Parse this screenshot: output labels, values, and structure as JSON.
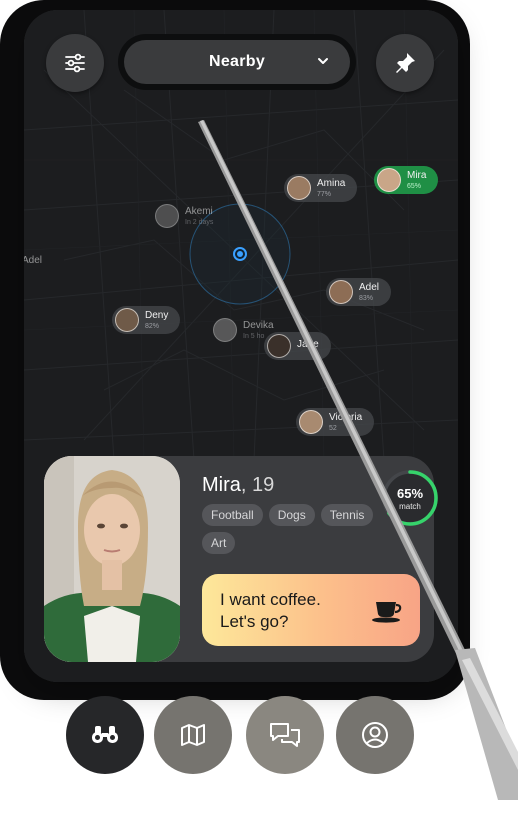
{
  "header": {
    "location_filter": "Nearby"
  },
  "icons": {
    "filter": "sliders-icon",
    "pin": "pushpin-icon",
    "dropdown": "chevron-down-icon",
    "coffee": "coffee-cup-icon",
    "nav": [
      "binoculars-icon",
      "map-icon",
      "chat-bubbles-icon",
      "user-circle-icon"
    ]
  },
  "map": {
    "edge_label": "Adel",
    "people": [
      {
        "name": "Amina",
        "info": "77%"
      },
      {
        "name": "Mira",
        "info": "65%"
      },
      {
        "name": "Akemi",
        "info": "In 2 days"
      },
      {
        "name": "Adel",
        "info": "83%"
      },
      {
        "name": "Deny",
        "info": "82%"
      },
      {
        "name": "Devika",
        "info": "In 5 ho"
      },
      {
        "name": "Jane",
        "info": ""
      },
      {
        "name": "Victoria",
        "info": "52"
      }
    ]
  },
  "profile_card": {
    "name": "Mira",
    "age": ", 19",
    "tags": [
      "Football",
      "Dogs",
      "Tennis",
      "Art"
    ],
    "match_percent": "65%",
    "match_label": "match",
    "match_value": 0.65,
    "message_line1": "I want coffee.",
    "message_line2": "Let's go?"
  },
  "colors": {
    "accent_green": "#1f8f45",
    "ring_green": "#36d36b",
    "message_gradient_start": "#fde89a",
    "message_gradient_end": "#f8a486",
    "user_dot": "#3aa0ff"
  }
}
